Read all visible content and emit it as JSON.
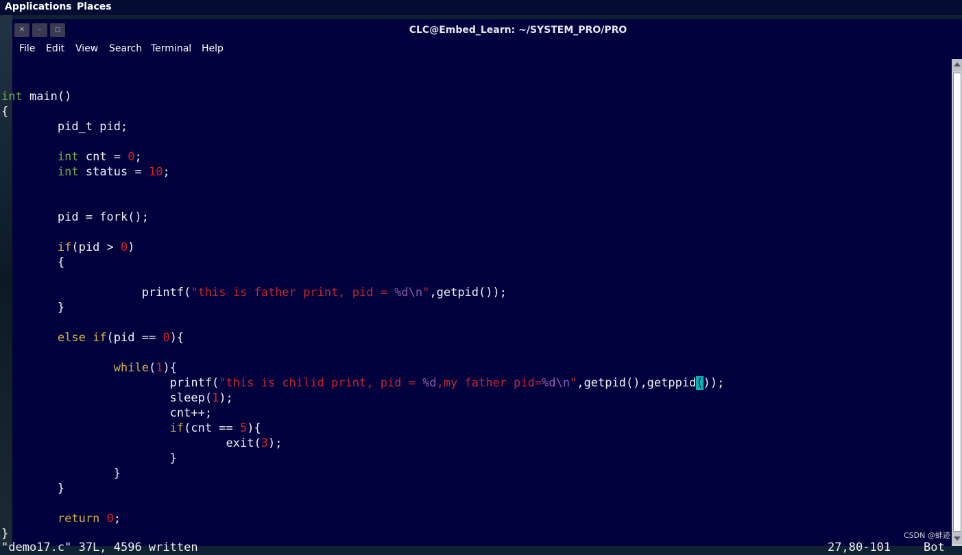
{
  "top_panel": {
    "applications_label": "Applications",
    "places_label": "Places"
  },
  "window": {
    "title": "CLC@Embed_Learn: ~/SYSTEM_PRO/PRO",
    "close_glyph": "✕",
    "minimize_glyph": "–",
    "maximize_glyph": "◻"
  },
  "menu": {
    "items": [
      "File",
      "Edit",
      "View",
      "Search",
      "Terminal",
      "Help"
    ]
  },
  "code": {
    "l1": {
      "kw": "int",
      "rest": " main()"
    },
    "l2": "{",
    "l3": "        pid_t pid;",
    "l4": {
      "kw": "int",
      "a": " cnt = ",
      "num": "0",
      "b": ";"
    },
    "l5": {
      "kw": "int",
      "a": " status = ",
      "num": "10",
      "b": ";"
    },
    "l6": "        pid = fork();",
    "l7": {
      "kw": "if",
      "a": "(pid > ",
      "num": "0",
      "b": ")"
    },
    "l8": "        {",
    "l9": {
      "a": "printf(",
      "str": "\"this is father print, pid = ",
      "esc": "%d\\n",
      "strend": "\"",
      "b": ",getpid());"
    },
    "l10": "        }",
    "l11": {
      "kw": "else if",
      "a": "(pid == ",
      "num": "0",
      "b": "){"
    },
    "l12": {
      "kw": "while",
      "a": "(",
      "num": "1",
      "b": "){"
    },
    "l13": {
      "a": "printf(",
      "str": "\"this is chilid print, pid = ",
      "esc1": "%d",
      "str2": ",my father pid=",
      "esc2": "%d\\n",
      "strend": "\"",
      "b": ",getpid(),getppid",
      "cursor": "(",
      "c": ")",
      "d": ");"
    },
    "l14": {
      "a": "sleep(",
      "num": "1",
      "b": ");"
    },
    "l15": "cnt++;",
    "l16": {
      "kw": "if",
      "a": "(cnt == ",
      "num": "5",
      "b": "){"
    },
    "l17": {
      "a": "exit(",
      "num": "3",
      "b": ");"
    },
    "l18": "}",
    "l19": "}",
    "l20": "        }",
    "l21": {
      "kw": "return",
      "a": " ",
      "num": "0",
      "b": ";"
    },
    "l22": "}"
  },
  "status_line": {
    "left": "\"demo17.c\" 37L, 4596 written",
    "position": "27,80-101",
    "scroll": "Bot"
  },
  "watermark": "CSDN @蚌迹",
  "colors": {
    "background": "#01013d",
    "keyword": "#6fb04a",
    "keyword_control": "#d8b040",
    "number": "#d72222",
    "string": "#c8252a",
    "escape": "#8f5ca8",
    "cursor": "#00b5b5"
  }
}
